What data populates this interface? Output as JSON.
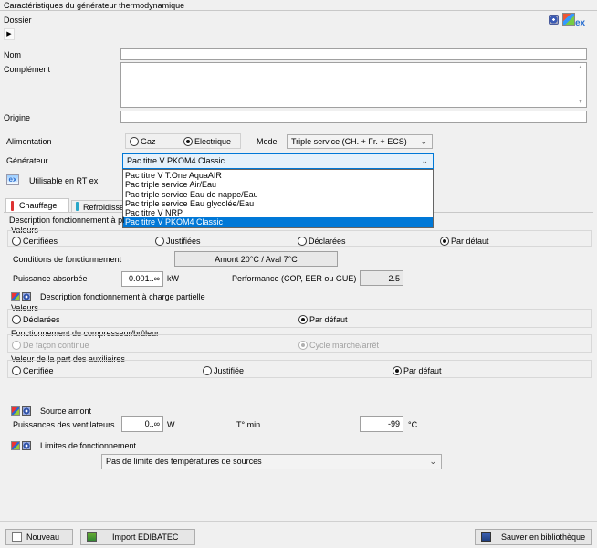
{
  "window": {
    "title": "Caractéristiques du générateur thermodynamique"
  },
  "dossier": {
    "label": "Dossier",
    "expand_icon": "triangle-right-icon"
  },
  "header_icons": [
    "snowflake-icon",
    "multicolor-icon",
    "ex-icon"
  ],
  "header_ex_label": "ex",
  "fields": {
    "nom": {
      "label": "Nom",
      "value": ""
    },
    "complement": {
      "label": "Complément",
      "value": ""
    },
    "origine": {
      "label": "Origine",
      "value": ""
    }
  },
  "alimentation": {
    "label": "Alimentation",
    "options": [
      {
        "label": "Gaz",
        "selected": false
      },
      {
        "label": "Electrique",
        "selected": true
      }
    ]
  },
  "mode": {
    "label": "Mode",
    "value": "Triple service (CH. + Fr. + ECS)"
  },
  "generateur": {
    "label": "Générateur",
    "value": "Pac titre V PKOM4 Classic",
    "dropdown_open": true,
    "options": [
      "Pac titre V T.One AquaAIR",
      "Pac triple service Air/Eau",
      "Pac triple service Eau de nappe/Eau",
      "Pac triple service Eau glycolée/Eau",
      "Pac titre V NRP",
      "Pac titre V PKOM4 Classic"
    ],
    "selected_index": 5
  },
  "rt_ex": {
    "label": "Utilisable en RT ex.",
    "icon_text": "ex"
  },
  "tabs": [
    {
      "label": "Chauffage",
      "active": true,
      "icon": "thermometer-icon"
    },
    {
      "label": "Refroidisse",
      "active": false,
      "icon": "thermometer-blue-icon"
    }
  ],
  "pleine_charge": {
    "title": "Description fonctionnement à pl",
    "valeurs_label": "Valeurs",
    "valeurs_options": [
      {
        "label": "Certifiées",
        "selected": false
      },
      {
        "label": "Justifiées",
        "selected": false
      },
      {
        "label": "Déclarées",
        "selected": false
      },
      {
        "label": "Par défaut",
        "selected": true
      }
    ],
    "conditions_label": "Conditions de fonctionnement",
    "conditions_value": "Amont 20°C / Aval 7°C",
    "puissance_label": "Puissance absorbée",
    "puissance_value": "0.001..∞",
    "puissance_unit": "kW",
    "performance_label": "Performance (COP, EER ou GUE)",
    "performance_value": "2.5"
  },
  "charge_partielle": {
    "title": "Description fonctionnement à charge partielle",
    "valeurs_label": "Valeurs",
    "valeurs_options": [
      {
        "label": "Déclarées",
        "selected": false
      },
      {
        "label": "Par défaut",
        "selected": true
      }
    ],
    "compresseur_label": "Fonctionnement du compresseur/brûleur",
    "compresseur_options": [
      {
        "label": "De façon continue",
        "selected": false,
        "disabled": true
      },
      {
        "label": "Cycle marche/arrêt",
        "selected": true,
        "disabled": true
      }
    ],
    "auxiliaires_label": "Valeur de la part des auxiliaires",
    "auxiliaires_options": [
      {
        "label": "Certifiée",
        "selected": false
      },
      {
        "label": "Justifiée",
        "selected": false
      },
      {
        "label": "Par défaut",
        "selected": true
      }
    ]
  },
  "source_amont": {
    "title": "Source amont",
    "ventilateurs_label": "Puissances des ventilateurs",
    "ventilateurs_value": "0..∞",
    "ventilateurs_unit": "W",
    "tmin_label": "T° min.",
    "tmin_value": "-99",
    "tmin_unit": "°C"
  },
  "limites": {
    "title": "Limites de fonctionnement",
    "value": "Pas de limite des températures de sources"
  },
  "footer": {
    "nouveau": "Nouveau",
    "import": "Import EDIBATEC",
    "sauver": "Sauver en bibliothèque"
  }
}
